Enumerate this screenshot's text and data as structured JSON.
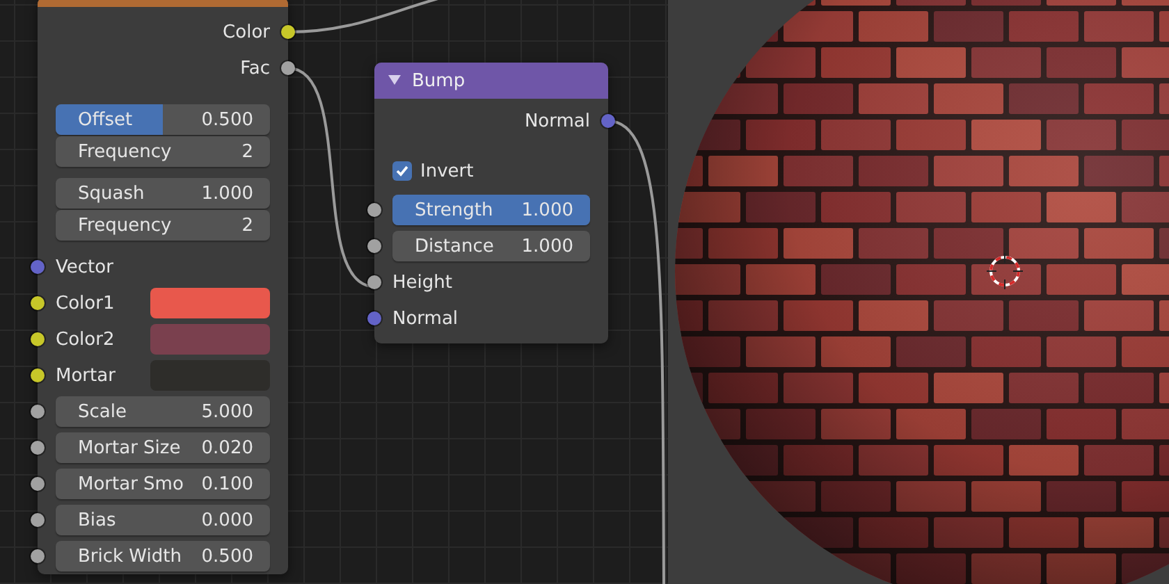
{
  "brick_node": {
    "outputs": [
      {
        "label": "Color",
        "socket": {
          "color": "#c7c729"
        }
      },
      {
        "label": "Fac",
        "socket": {
          "color": "#a1a1a1"
        }
      }
    ],
    "field_groups": [
      [
        {
          "label": "Offset",
          "value": "0.500",
          "kind": "slider",
          "level": 0.5
        },
        {
          "label": "Frequency",
          "value": "2",
          "kind": "number"
        }
      ],
      [
        {
          "label": "Squash",
          "value": "1.000",
          "kind": "number"
        },
        {
          "label": "Frequency",
          "value": "2",
          "kind": "number"
        }
      ]
    ],
    "inputs": [
      {
        "label": "Vector",
        "socket": {
          "color": "#6363c7"
        },
        "kind": "label"
      },
      {
        "label": "Color1",
        "socket": {
          "color": "#c7c729"
        },
        "kind": "color",
        "color": "#e8584c"
      },
      {
        "label": "Color2",
        "socket": {
          "color": "#c7c729"
        },
        "kind": "color",
        "color": "#7a404e"
      },
      {
        "label": "Mortar",
        "socket": {
          "color": "#c7c729"
        },
        "kind": "color",
        "color": "#2e2d2a"
      },
      {
        "label": "Scale",
        "socket": {
          "color": "#a1a1a1"
        },
        "kind": "number",
        "value": "5.000"
      },
      {
        "label": "Mortar Size",
        "socket": {
          "color": "#a1a1a1"
        },
        "kind": "number",
        "value": "0.020"
      },
      {
        "label": "Mortar Smo",
        "socket": {
          "color": "#a1a1a1"
        },
        "kind": "number",
        "value": "0.100"
      },
      {
        "label": "Bias",
        "socket": {
          "color": "#a1a1a1"
        },
        "kind": "number",
        "value": "0.000"
      },
      {
        "label": "Brick Width",
        "socket": {
          "color": "#a1a1a1"
        },
        "kind": "number",
        "value": "0.500"
      }
    ]
  },
  "bump_node": {
    "title": "Bump",
    "expanded": true,
    "outputs": [
      {
        "label": "Normal",
        "socket": {
          "color": "#6363c7"
        }
      }
    ],
    "invert": {
      "label": "Invert",
      "checked": true
    },
    "inputs": [
      {
        "label": "Strength",
        "socket": {
          "color": "#a1a1a1"
        },
        "kind": "slider",
        "value": "1.000",
        "level": 1
      },
      {
        "label": "Distance",
        "socket": {
          "color": "#a1a1a1"
        },
        "kind": "number",
        "value": "1.000"
      },
      {
        "label": "Height",
        "socket": {
          "color": "#a1a1a1"
        },
        "kind": "label"
      },
      {
        "label": "Normal",
        "socket": {
          "color": "#6363c7"
        },
        "kind": "label"
      }
    ]
  }
}
